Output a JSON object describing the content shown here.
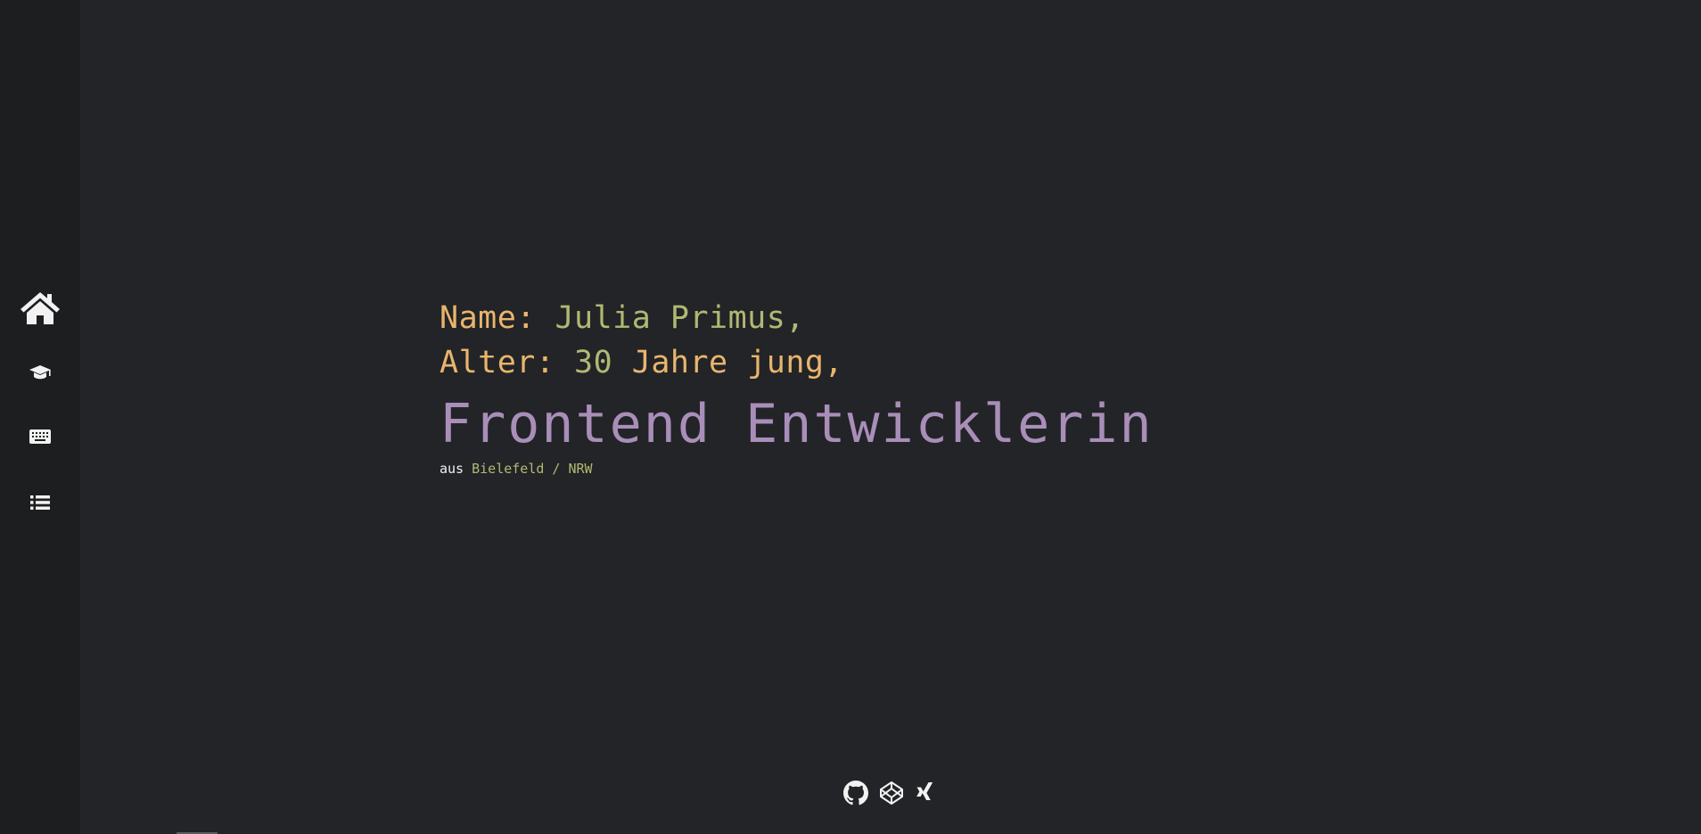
{
  "sidebar": {
    "items": [
      {
        "icon": "home-icon",
        "label": "Home"
      },
      {
        "icon": "graduation-cap-icon",
        "label": "Ausbildung"
      },
      {
        "icon": "keyboard-icon",
        "label": "Skills"
      },
      {
        "icon": "list-icon",
        "label": "Projekte"
      }
    ]
  },
  "intro": {
    "name_label": "Name:",
    "name_value": "Julia Primus,",
    "age_label": "Alter:",
    "age_number": "30",
    "age_suffix": "Jahre jung,",
    "title": "Frontend Entwicklerin",
    "location_prefix": "aus",
    "location_value": "Bielefeld / NRW"
  },
  "social": [
    {
      "icon": "github-icon",
      "label": "GitHub"
    },
    {
      "icon": "codepen-icon",
      "label": "CodePen"
    },
    {
      "icon": "xing-icon",
      "label": "XING"
    }
  ],
  "colors": {
    "background": "#232427",
    "sidebar": "#1d1e20",
    "orange": "#e9b56d",
    "green": "#b1b873",
    "purple": "#a98eb9",
    "white": "#f0f0f0"
  }
}
